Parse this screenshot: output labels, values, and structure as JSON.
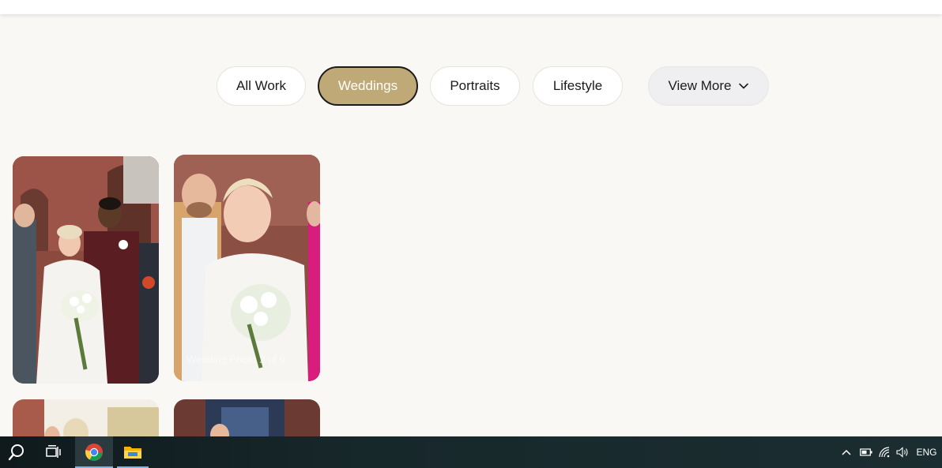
{
  "filters": [
    {
      "label": "All Work",
      "active": false
    },
    {
      "label": "Weddings",
      "active": true
    },
    {
      "label": "Portraits",
      "active": false
    },
    {
      "label": "Lifestyle",
      "active": false
    }
  ],
  "view_more": {
    "label": "View More",
    "icon": "chevron-down-icon"
  },
  "gallery": {
    "photo_2_caption": "Wedding Photo 2 of 9"
  },
  "taskbar": {
    "icons": [
      "search-icon",
      "task-view-icon",
      "chrome-icon",
      "file-explorer-icon"
    ],
    "tray_icons": [
      "chevron-up-icon",
      "battery-icon",
      "wifi-icon",
      "volume-icon"
    ],
    "language": "ENG"
  },
  "colors": {
    "accent": "#bfa976",
    "page_bg": "#f9f8f4",
    "taskbar_bg": "#17282b"
  }
}
